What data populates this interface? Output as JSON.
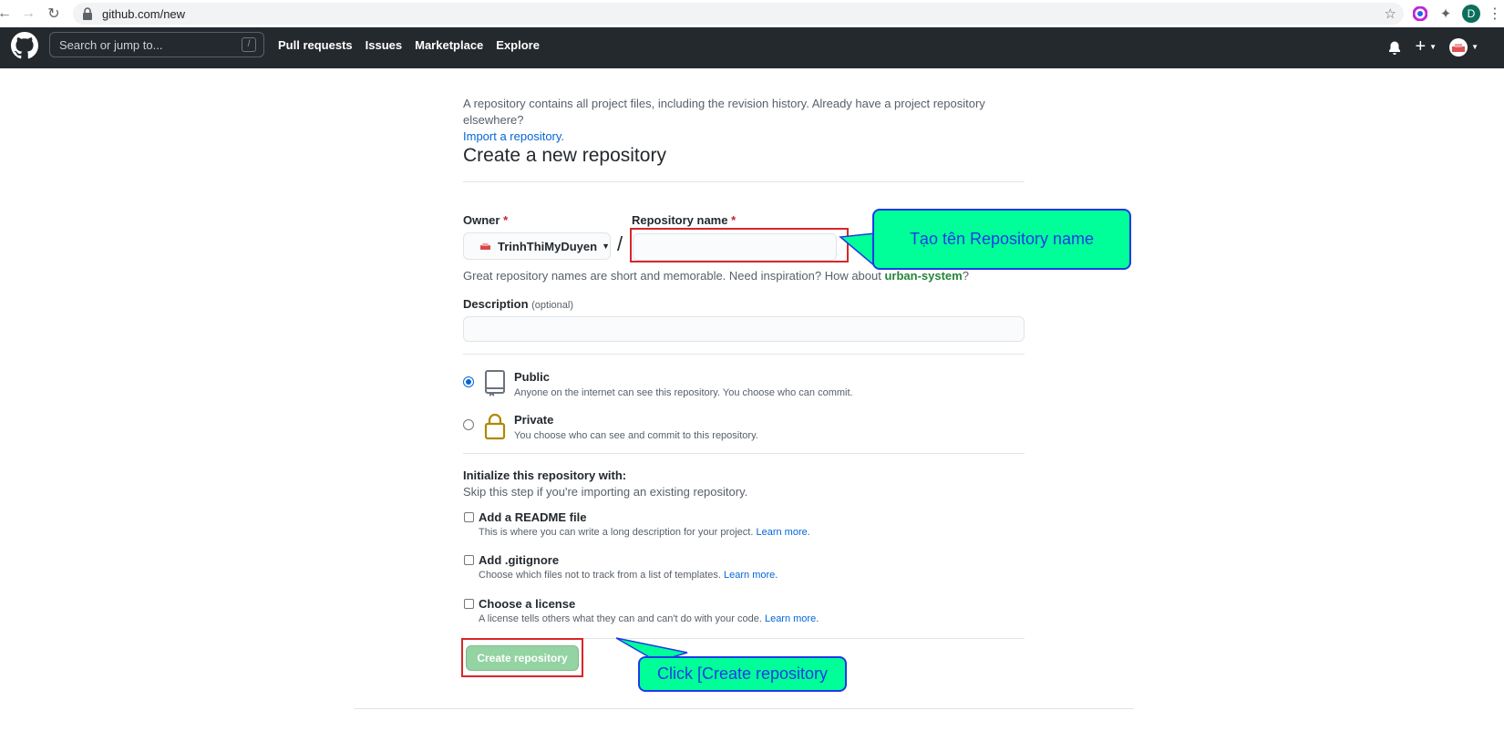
{
  "browser": {
    "url": "github.com/new",
    "profile_initial": "D"
  },
  "header": {
    "search_placeholder": "Search or jump to...",
    "search_shortcut": "/",
    "nav": [
      "Pull requests",
      "Issues",
      "Marketplace",
      "Explore"
    ],
    "plus_label": "+"
  },
  "intro": {
    "text": "A repository contains all project files, including the revision history. Already have a project repository elsewhere?",
    "link": "Import a repository."
  },
  "page_title": "Create a new repository",
  "owner": {
    "label": "Owner",
    "required_mark": "*",
    "value": "TrinhThiMyDuyen"
  },
  "repo_name": {
    "label": "Repository name",
    "required_mark": "*",
    "value": "",
    "separator": "/"
  },
  "hint": {
    "text": "Great repository names are short and memorable. Need inspiration? How about ",
    "suggestion": "urban-system",
    "end": "?"
  },
  "description": {
    "label": "Description",
    "optional": "(optional)",
    "value": ""
  },
  "visibility": {
    "public": {
      "title": "Public",
      "desc": "Anyone on the internet can see this repository. You choose who can commit.",
      "checked": true
    },
    "private": {
      "title": "Private",
      "desc": "You choose who can see and commit to this repository.",
      "checked": false
    }
  },
  "init": {
    "title": "Initialize this repository with:",
    "subtitle": "Skip this step if you're importing an existing repository.",
    "options": [
      {
        "title": "Add a README file",
        "desc": "This is where you can write a long description for your project.",
        "link": "Learn more."
      },
      {
        "title": "Add .gitignore",
        "desc": "Choose which files not to track from a list of templates.",
        "link": "Learn more."
      },
      {
        "title": "Choose a license",
        "desc": "A license tells others what they can and can't do with your code.",
        "link": "Learn more."
      }
    ]
  },
  "create_button": "Create repository",
  "callouts": {
    "repo_name": "Tạo tên Repository name",
    "create": "Click [Create repository"
  },
  "colors": {
    "header_bg": "#24292e",
    "callout_bg": "#00ff99",
    "callout_text": "#1e3ae6",
    "highlight_border": "#d8262a",
    "create_btn": "#94d3a2"
  }
}
